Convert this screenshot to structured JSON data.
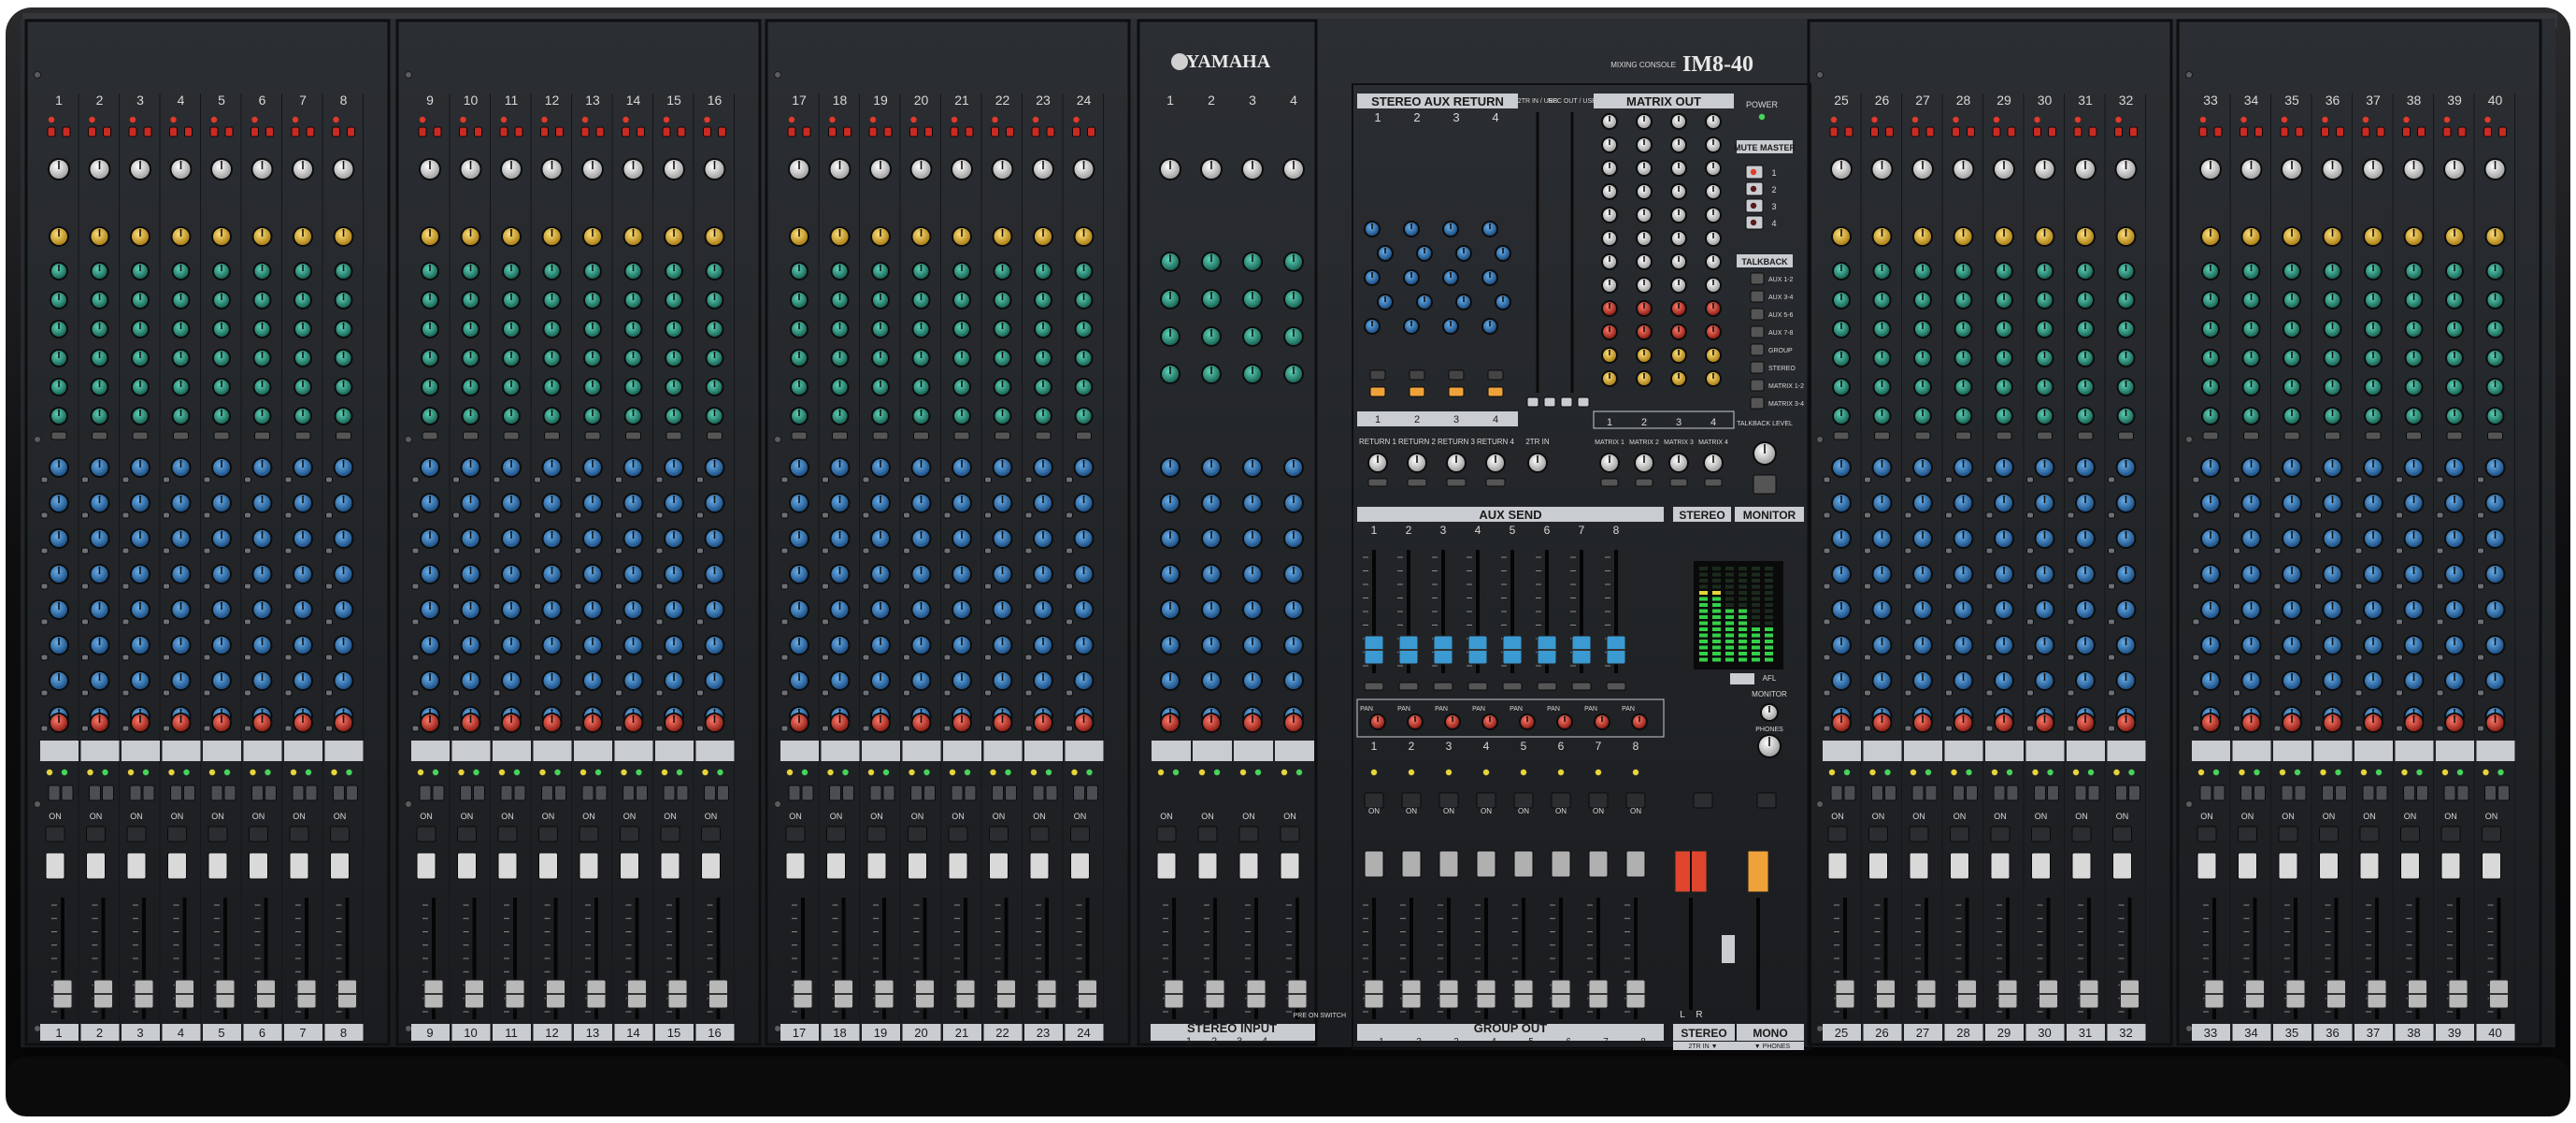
{
  "brand": {
    "manufacturer": "YAMAHA",
    "series_caption": "MIXING CONSOLE",
    "model": "IM8-40"
  },
  "colors": {
    "panel": "#1e2124",
    "frame": "#111214",
    "stripe_light": "#c9ccd0",
    "knob_gain": "#e8e8e8",
    "knob_hpf": "#e0b23a",
    "knob_eq": "#2d8f7b",
    "knob_aux": "#2e6fae",
    "knob_pan": "#c63a2f",
    "fader_cap": "#d9d9d9",
    "aux_fader_cap": "#3b9ad1",
    "stereo_fader_cap": "#e0452e",
    "mono_fader_cap": "#f0a23a",
    "meter_green": "#35d04a",
    "meter_yellow": "#e6d63a",
    "meter_red": "#e23a2a"
  },
  "input_channels": {
    "banks": [
      {
        "numbers": [
          "1",
          "2",
          "3",
          "4",
          "5",
          "6",
          "7",
          "8"
        ]
      },
      {
        "numbers": [
          "9",
          "10",
          "11",
          "12",
          "13",
          "14",
          "15",
          "16"
        ]
      },
      {
        "numbers": [
          "17",
          "18",
          "19",
          "20",
          "21",
          "22",
          "23",
          "24"
        ]
      },
      {
        "numbers": [
          "25",
          "26",
          "27",
          "28",
          "29",
          "30",
          "31",
          "32"
        ]
      },
      {
        "numbers": [
          "33",
          "34",
          "35",
          "36",
          "37",
          "38",
          "39",
          "40"
        ]
      }
    ],
    "on_label": "ON"
  },
  "stereo_input": {
    "title": "STEREO INPUT",
    "numbers": [
      "1",
      "2",
      "3",
      "4"
    ]
  },
  "master": {
    "stereo_aux_return": {
      "title": "STEREO AUX RETURN",
      "numbers": [
        "1",
        "2",
        "3",
        "4"
      ],
      "return_labels": [
        "RETURN 1",
        "RETURN 2",
        "RETURN 3",
        "RETURN 4"
      ],
      "twotr_in_label": "2TR IN",
      "twotr_usb_label": "2TR IN / USB",
      "rec_out_usb_label": "REC OUT / USB"
    },
    "matrix_out": {
      "title": "MATRIX OUT",
      "numbers": [
        "1",
        "2",
        "3",
        "4"
      ],
      "matrix_labels": [
        "MATRIX 1",
        "MATRIX 2",
        "MATRIX 3",
        "MATRIX 4"
      ]
    },
    "power_label": "POWER",
    "mute_master": {
      "title": "MUTE MASTER",
      "numbers": [
        "1",
        "2",
        "3",
        "4"
      ]
    },
    "talkback": {
      "title": "TALKBACK",
      "assign_labels": [
        "AUX 1-2",
        "AUX 3-4",
        "AUX 5-6",
        "AUX 7-8",
        "GROUP",
        "STEREO",
        "MATRIX 1-2",
        "MATRIX 3-4"
      ],
      "level_label": "TALKBACK LEVEL"
    },
    "aux_send": {
      "title": "AUX SEND",
      "numbers": [
        "1",
        "2",
        "3",
        "4",
        "5",
        "6",
        "7",
        "8"
      ]
    },
    "group_out": {
      "title": "GROUP OUT",
      "numbers": [
        "1",
        "2",
        "3",
        "4",
        "5",
        "6",
        "7",
        "8"
      ],
      "pan_label": "PAN"
    },
    "stereo": {
      "title": "STEREO",
      "lr_labels": [
        "L",
        "R"
      ]
    },
    "monitor": {
      "title": "MONITOR",
      "pfl_label": "PFL",
      "afl_label": "AFL",
      "monitor_label": "MONITOR",
      "phones_label": "PHONES"
    },
    "mono_title": "MONO",
    "footer_labels": [
      "2TR IN ▼",
      "▼ PHONES"
    ],
    "pre_on_label": "PRE ON SWITCH"
  }
}
